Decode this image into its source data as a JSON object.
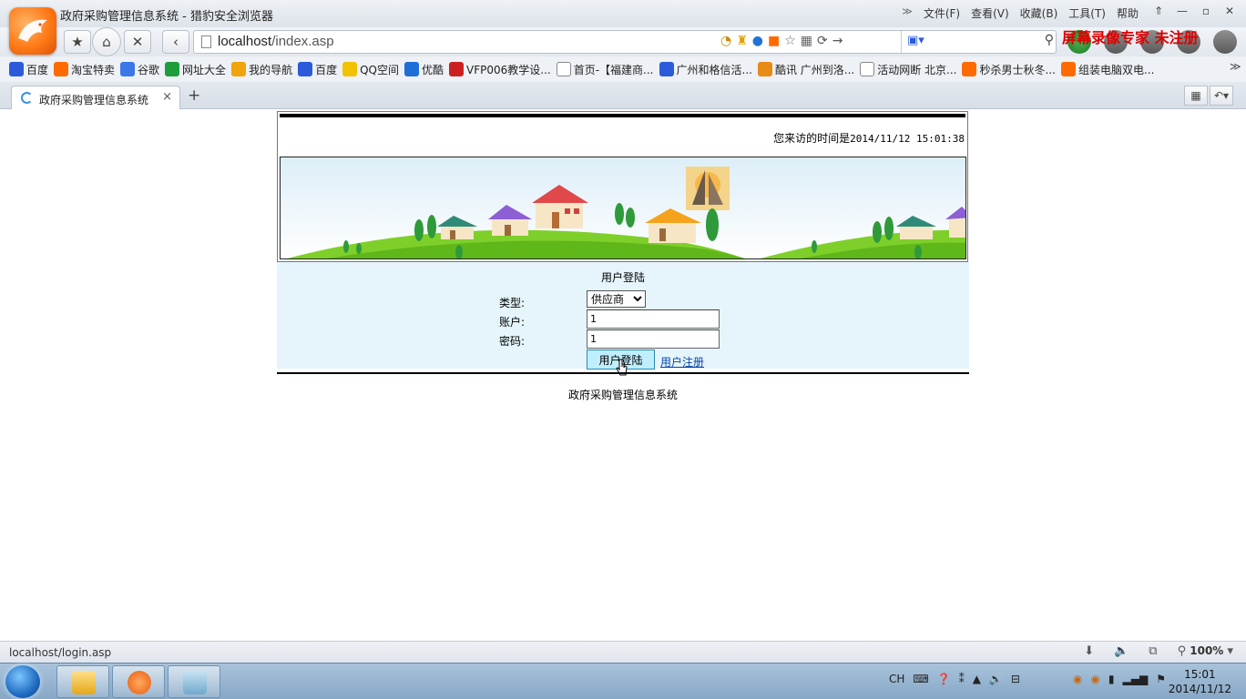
{
  "window": {
    "title": "政府采购管理信息系统 - 猎豹安全浏览器",
    "menu": [
      "文件(F)",
      "查看(V)",
      "收藏(B)",
      "工具(T)",
      "帮助"
    ],
    "controls": [
      "⇑",
      "—",
      "▫",
      "✕"
    ]
  },
  "navbar": {
    "address_host": "localhost",
    "address_path": "/index.asp",
    "search_placeholder": ""
  },
  "watermark": "屏幕录像专家 未注册",
  "bookmarks": [
    {
      "label": "百度",
      "icon": "baidu-paw-icon",
      "color": "#2b5bd8"
    },
    {
      "label": "淘宝特卖",
      "icon": "taobao-icon",
      "color": "#ff6a00"
    },
    {
      "label": "谷歌",
      "icon": "google-icon",
      "color": "#3b78e7"
    },
    {
      "label": "网址大全",
      "icon": "hao123-icon",
      "color": "#1e9e3a"
    },
    {
      "label": "我的导航",
      "icon": "folder-icon",
      "color": "#f0a30a"
    },
    {
      "label": "百度",
      "icon": "baidu-paw-icon",
      "color": "#2b5bd8"
    },
    {
      "label": "QQ空间",
      "icon": "qzone-star-icon",
      "color": "#f2c200"
    },
    {
      "label": "优酷",
      "icon": "youku-play-icon",
      "color": "#1d6fd6"
    },
    {
      "label": "VFP006教学设...",
      "icon": "red-page-icon",
      "color": "#cc2020"
    },
    {
      "label": "首页-【福建商...",
      "icon": "page-icon",
      "color": "#ffffff"
    },
    {
      "label": "广州和格信活...",
      "icon": "baidu-paw-icon",
      "color": "#2b5bd8"
    },
    {
      "label": "酷讯 广州到洛...",
      "icon": "kuxun-icon",
      "color": "#e88a16"
    },
    {
      "label": "活动网断 北京...",
      "icon": "page-icon",
      "color": "#ffffff"
    },
    {
      "label": "秒杀男士秋冬...",
      "icon": "taobao-icon",
      "color": "#ff6a00"
    },
    {
      "label": "组装电脑双电...",
      "icon": "taobao-icon",
      "color": "#ff6a00"
    }
  ],
  "tab": {
    "label": "政府采购管理信息系统",
    "close": "×",
    "new": "+"
  },
  "page": {
    "visit_time_label": "您来访的时间是",
    "visit_time_value": "2014/11/12 15:01:38",
    "login_title": "用户登陆",
    "type_label": "类型:",
    "account_label": "账户:",
    "password_label": "密码:",
    "type_selected": "供应商",
    "account_value": "1",
    "password_value": "1",
    "login_button": "用户登陆",
    "register_link": "用户注册",
    "footer": "政府采购管理信息系统"
  },
  "status": {
    "url": "localhost/login.asp",
    "zoom": "100%"
  },
  "taskbar": {
    "ime": "CH",
    "time": "15:01",
    "date": "2014/11/12"
  }
}
